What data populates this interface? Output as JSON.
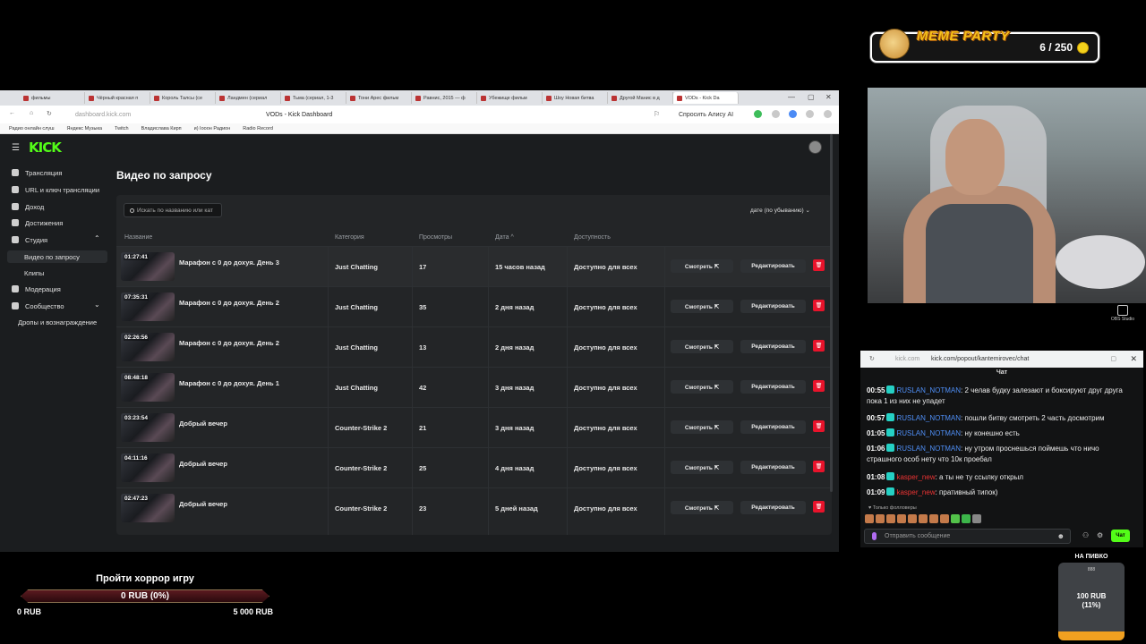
{
  "overlay": {
    "meme_party": {
      "title": "MEME PARTY",
      "count": "6 / 250"
    },
    "goal": {
      "title": "Пройти хоррор игру",
      "bar_text": "0 RUB (0%)",
      "min": "0 RUB",
      "max": "5 000 RUB",
      "progress": 0
    },
    "beer": {
      "title": "НА ПИВКО",
      "count": "888",
      "amount_line1": "100 RUB",
      "amount_line2": "(11%)",
      "progress": 0.11
    },
    "obs_label": "OBS Studio"
  },
  "browser": {
    "tabs": [
      "фильмы",
      "Чёрный красная п",
      "Король Талсы (се",
      "Ландмен (сериал",
      "Тьма (сериал, 1-3",
      "Тони Арес фильм",
      "Равнис, 2015 — ф",
      "Убежище фильм",
      "Шоу Новая битва",
      "Другой Манис в д",
      "VODs - Kick Da"
    ],
    "url": "dashboard.kick.com",
    "page_title": "VODs - Kick Dashboard",
    "alice": "Спросить Алису AI",
    "bookmarks": [
      "Радио онлайн слуш",
      "Яндекс Музыка",
      "Twitch",
      "Владислава Кирп",
      "и) Іооон Радион",
      "Radio Record"
    ]
  },
  "dashboard": {
    "logo": "KICK",
    "sidebar": [
      {
        "label": "Трансляция"
      },
      {
        "label": "URL и ключ трансляции"
      },
      {
        "label": "Доход"
      },
      {
        "label": "Достижения"
      },
      {
        "label": "Студия"
      },
      {
        "label": "Видео по запросу"
      },
      {
        "label": "Клипы"
      },
      {
        "label": "Модерация"
      },
      {
        "label": "Сообщество"
      },
      {
        "label": "Дропы и вознаграждение"
      }
    ],
    "title": "Видео по запросу",
    "search_placeholder": "Искать по названию или кат",
    "sort_label": "дате (по убыванию)",
    "columns": {
      "name": "Название",
      "category": "Категория",
      "views": "Просмотры",
      "date": "Дата ^",
      "availability": "Доступность"
    },
    "watch_label": "Смотреть ⇱",
    "edit_label": "Редактировать",
    "rows": [
      {
        "duration": "01:27:41",
        "name": "Марафон с 0 до дохуя. День 3",
        "category": "Just Chatting",
        "views": "17",
        "date": "15 часов назад",
        "availability": "Доступно для всех"
      },
      {
        "duration": "07:35:31",
        "name": "Марафон с 0 до дохуя. День 2",
        "category": "Just Chatting",
        "views": "35",
        "date": "2 дня назад",
        "availability": "Доступно для всех"
      },
      {
        "duration": "02:26:56",
        "name": "Марафон с 0 до дохуя. День 2",
        "category": "Just Chatting",
        "views": "13",
        "date": "2 дня назад",
        "availability": "Доступно для всех"
      },
      {
        "duration": "08:48:18",
        "name": "Марафон с 0 до дохуя. День 1",
        "category": "Just Chatting",
        "views": "42",
        "date": "3 дня назад",
        "availability": "Доступно для всех"
      },
      {
        "duration": "03:23:54",
        "name": "Добрый вечер",
        "category": "Counter-Strike 2",
        "views": "21",
        "date": "3 дня назад",
        "availability": "Доступно для всех"
      },
      {
        "duration": "04:11:16",
        "name": "Добрый вечер",
        "category": "Counter-Strike 2",
        "views": "25",
        "date": "4 дня назад",
        "availability": "Доступно для всех"
      },
      {
        "duration": "02:47:23",
        "name": "Добрый вечер",
        "category": "Counter-Strike 2",
        "views": "23",
        "date": "5 дней назад",
        "availability": "Доступно для всех"
      }
    ]
  },
  "chat": {
    "url_host": "kick.com",
    "url_path": "kick.com/popout/kantemirovec/chat",
    "header": "Чат",
    "messages": [
      {
        "time": "00:55",
        "user": "RUSLAN_NOTMAN",
        "text": ": 2 челав будку залезают и боксируют друг друга пока 1 из них не упадет",
        "color": "#4f8ff7"
      },
      {
        "time": "00:57",
        "user": "RUSLAN_NOTMAN",
        "text": ": пошли битву смотреть 2 часть досмотрим",
        "color": "#4f8ff7"
      },
      {
        "time": "01:05",
        "user": "RUSLAN_NOTMAN",
        "text": ": ну конешно есть",
        "color": "#4f8ff7"
      },
      {
        "time": "01:06",
        "user": "RUSLAN_NOTMAN",
        "text": ": ну утром проснешься поймешь что ничо страшного особ нету что 10к проебал",
        "color": "#4f8ff7"
      },
      {
        "time": "01:08",
        "user": "kasper_new",
        "text": ": а ты не ту ссылку открыл",
        "color": "#e33"
      },
      {
        "time": "01:09",
        "user": "kasper_new",
        "text": ": пративный типок)",
        "color": "#e33"
      }
    ],
    "followers_only": "♥ Только фолловеры",
    "input_placeholder": "Отправить сообщение",
    "send_label": "Чат"
  },
  "colors": {
    "kick_green": "#53fc18",
    "delete_red": "#e8132b",
    "goal_bar": "#5b1a20"
  }
}
